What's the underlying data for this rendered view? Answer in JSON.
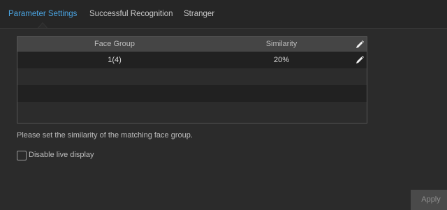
{
  "tabs": [
    {
      "label": "Parameter Settings",
      "active": true
    },
    {
      "label": "Successful Recognition",
      "active": false
    },
    {
      "label": "Stranger",
      "active": false
    }
  ],
  "table": {
    "columns": [
      "Face Group",
      "Similarity"
    ],
    "rows": [
      {
        "face_group": "1(4)",
        "similarity": "20%"
      }
    ]
  },
  "hint": "Please set the similarity of the matching face group.",
  "disable_live_display": {
    "label": "Disable live display",
    "checked": false
  },
  "apply_label": "Apply",
  "colors": {
    "accent": "#4aa3e0",
    "background": "#2b2b2b",
    "header": "#454545"
  },
  "icons": {
    "header_edit": "pencil-icon",
    "row_edit": "pencil-icon"
  }
}
